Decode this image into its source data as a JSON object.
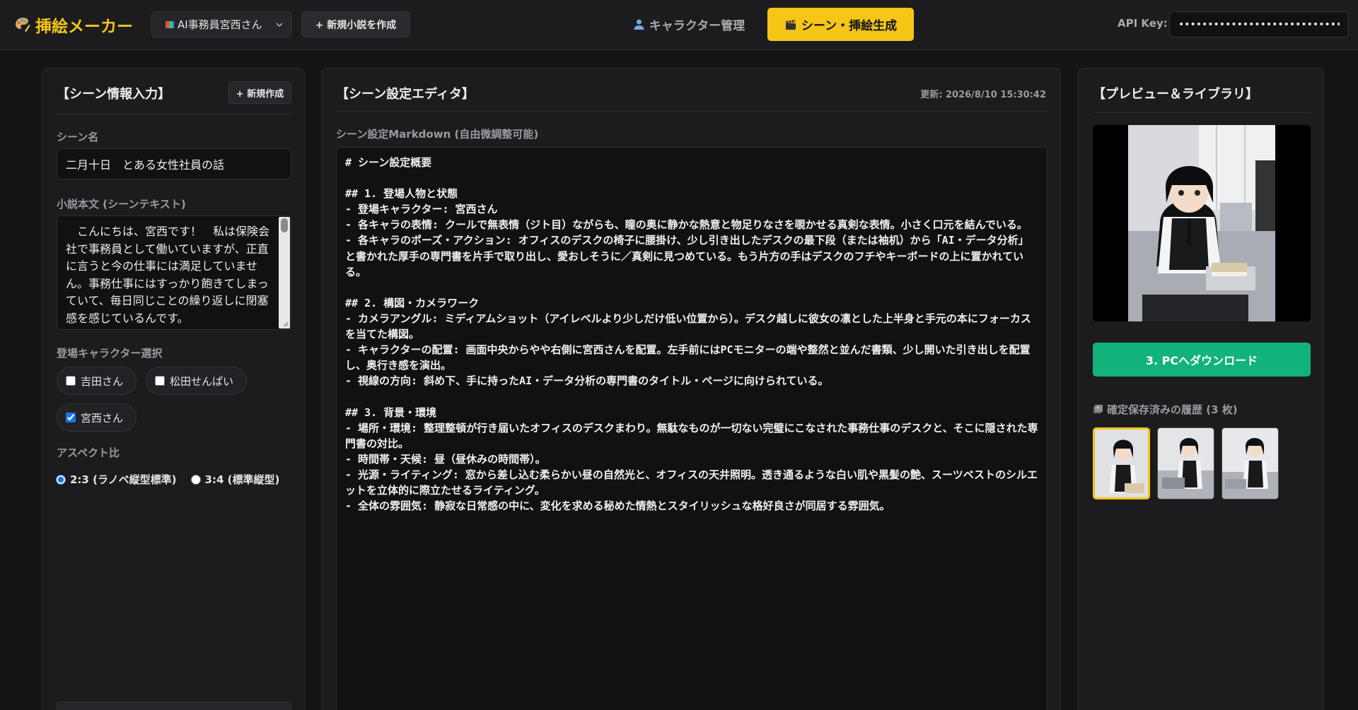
{
  "app": {
    "title": "挿絵メーカー",
    "novel_select": "AI事務員宮西さん",
    "new_novel": "+ 新規小説を作成",
    "nav_character": "キャラクター管理",
    "nav_scene": "シーン・挿絵生成",
    "api_key_label": "API Key:",
    "api_key_value": "••••••••••••••••••••••••••••••••••••••••"
  },
  "left": {
    "title": "【シーン情報入力】",
    "new_button": "+ 新規作成",
    "scene_name_label": "シーン名",
    "scene_name": "二月十日　とある女性社員の話",
    "scene_text_label": "小説本文 (シーンテキスト)",
    "scene_text": "　こんにちは、宮西です！　私は保険会社で事務員として働いていますが、正直に言うと今の仕事には満足していません。事務仕事にはすっかり飽きてしまっていて、毎日同じことの繰り返しに閉塞感を感じているんです。",
    "characters_label": "登場キャラクター選択",
    "characters": [
      {
        "name": "吉田さん",
        "checked": false
      },
      {
        "name": "松田せんぱい",
        "checked": false
      },
      {
        "name": "宮西さん",
        "checked": true
      }
    ],
    "aspect_label": "アスペクト比",
    "aspect_options": [
      {
        "label": "2:3 (ラノベ縦型標準)",
        "selected": true
      },
      {
        "label": "3:4 (標準縦型)",
        "selected": false
      }
    ]
  },
  "middle": {
    "title": "【シーン設定エディタ】",
    "updated": "更新: 2026/8/10 15:30:42",
    "markdown_label": "シーン設定Markdown (自由微調整可能)",
    "markdown": "# シーン設定概要\n\n## 1. 登場人物と状態\n- 登場キャラクター: 宮西さん\n- 各キャラの表情: クールで無表情（ジト目）ながらも、瞳の奥に静かな熱意と物足りなさを覗かせる真剣な表情。小さく口元を結んでいる。\n- 各キャラのポーズ・アクション: オフィスのデスクの椅子に腰掛け、少し引き出したデスクの最下段（または袖机）から「AI・データ分析」と書かれた厚手の専門書を片手で取り出し、愛おしそうに／真剣に見つめている。もう片方の手はデスクのフチやキーボードの上に置かれている。\n\n## 2. 構図・カメラワーク\n- カメラアングル: ミディアムショット（アイレベルより少しだけ低い位置から）。デスク越しに彼女の凛とした上半身と手元の本にフォーカスを当てた構図。\n- キャラクターの配置: 画面中央からやや右側に宮西さんを配置。左手前にはPCモニターの端や整然と並んだ書類、少し開いた引き出しを配置し、奥行き感を演出。\n- 視線の方向: 斜め下、手に持ったAI・データ分析の専門書のタイトル・ページに向けられている。\n\n## 3. 背景・環境\n- 場所・環境: 整理整頓が行き届いたオフィスのデスクまわり。無駄なものが一切ない完璧にこなされた事務仕事のデスクと、そこに隠された専門書の対比。\n- 時間帯・天候: 昼（昼休みの時間帯）。\n- 光源・ライティング: 窓から差し込む柔らかい昼の自然光と、オフィスの天井照明。透き通るような白い肌や黒髪の艶、スーツベストのシルエットを立体的に際立たせるライティング。\n- 全体の雰囲気: 静寂な日常感の中に、変化を求める秘めた情熱とスタイリッシュな格好良さが同居する雰囲気。"
  },
  "right": {
    "title": "【プレビュー＆ライブラリ】",
    "download": "3. PCへダウンロード",
    "history_label": "確定保存済みの履歴 (3 枚)",
    "book_title": "AI・データ分析"
  },
  "colors": {
    "accent": "#f5c518",
    "download": "#12b37a",
    "background": "#141416",
    "panel": "#1c1c1f"
  }
}
